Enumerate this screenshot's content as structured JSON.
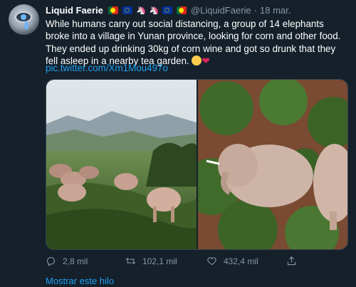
{
  "tweet": {
    "display_name": "Liquid Faerie",
    "handle": "@LiquidFaerie",
    "separator": "·",
    "date": "18 mar.",
    "name_emojis": [
      "flag-portugal",
      "flag-eu",
      "unicorn"
    ],
    "handle_emojis": [
      "unicorn",
      "flag-eu",
      "flag-portugal"
    ],
    "text": "While humans carry out social distancing, a group of 14 elephants broke into a village in Yunan province, looking for corn and other food. They ended up drinking 30kg of corn wine and got so drunk that they fell asleep in a nearby tea garden.",
    "text_emojis": [
      "tears-of-joy-emoji",
      "red-heart-emoji"
    ],
    "link": "pic.twitter.com/Xm1Mou497o",
    "media": [
      "elephants-walking-tea-field-photo",
      "elephants-sleeping-tea-garden-photo"
    ]
  },
  "actions": {
    "reply": "2,8 mil",
    "retweet": "102,1 mil",
    "like": "432,4 mil"
  },
  "show_thread": "Mostrar este hilo",
  "colors": {
    "background": "#15202b",
    "text": "#ffffff",
    "secondary": "#8899a6",
    "link": "#1da1f2",
    "border": "#38444d"
  }
}
